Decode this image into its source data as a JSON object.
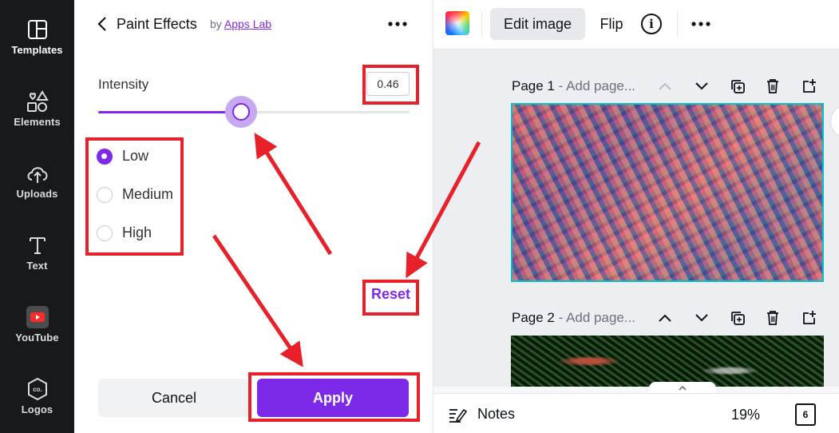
{
  "rail": {
    "items": [
      {
        "label": "Templates",
        "icon": "templates-icon",
        "active": true
      },
      {
        "label": "Elements",
        "icon": "elements-icon"
      },
      {
        "label": "Uploads",
        "icon": "uploads-icon"
      },
      {
        "label": "Text",
        "icon": "text-icon"
      },
      {
        "label": "YouTube",
        "icon": "youtube-icon"
      },
      {
        "label": "Logos",
        "icon": "logos-icon"
      }
    ]
  },
  "panel": {
    "title": "Paint Effects",
    "by_prefix": "by",
    "by_link": "Apps Lab",
    "intensity_label": "Intensity",
    "intensity_value": "0.46",
    "intensity_fraction": 0.46,
    "options": [
      {
        "label": "Low",
        "checked": true
      },
      {
        "label": "Medium",
        "checked": false
      },
      {
        "label": "High",
        "checked": false
      }
    ],
    "reset_label": "Reset",
    "cancel_label": "Cancel",
    "apply_label": "Apply"
  },
  "toolbar": {
    "edit_image_label": "Edit image",
    "flip_label": "Flip",
    "info_glyph": "i"
  },
  "canvas": {
    "pages": [
      {
        "title": "Page 1",
        "separator": " - ",
        "hint": "Add page..."
      },
      {
        "title": "Page 2",
        "separator": " - ",
        "hint": "Add page..."
      }
    ]
  },
  "bottombar": {
    "notes_label": "Notes",
    "zoom_label": "19%",
    "page_count": "6"
  },
  "colors": {
    "accent": "#7d2ae8",
    "annotation": "#e8202a",
    "selection": "#00c4cc",
    "rail_bg": "#18191b"
  }
}
